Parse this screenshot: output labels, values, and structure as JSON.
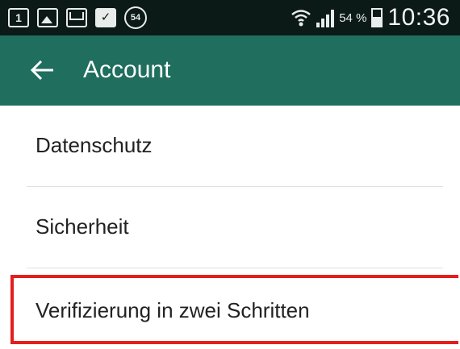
{
  "status_bar": {
    "notif_badge_1": "1",
    "notif_count": "54",
    "battery_percent": "54 %",
    "time": "10:36"
  },
  "app_bar": {
    "title": "Account",
    "back_icon": "arrow-left-icon"
  },
  "menu": {
    "items": [
      {
        "label": "Datenschutz"
      },
      {
        "label": "Sicherheit"
      },
      {
        "label": "Verifizierung in zwei Schritten"
      }
    ]
  },
  "colors": {
    "status_bar_bg": "#0b1a17",
    "app_bar_bg": "#1f6e5e",
    "highlight": "#e41e1e"
  }
}
